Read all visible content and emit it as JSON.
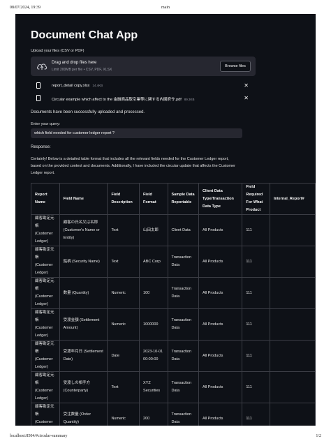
{
  "print_header": {
    "datetime": "08/07/2024, 19:39",
    "title": "main"
  },
  "print_footer": {
    "url": "localhost:8504/#circular-summary",
    "page": "1/2"
  },
  "app": {
    "title": "Document Chat App",
    "upload_label": "Upload your files (CSV or PDF)",
    "uploader": {
      "icon": "cloud-upload-icon",
      "main_text": "Drag and drop files here",
      "sub_text": "Limit 200MB per file • CSV, PDF, XLSX",
      "browse_label": "Browse files"
    },
    "files": [
      {
        "name": "report_detail copy.xlsx",
        "size": "14.4KB",
        "icon": "file-icon"
      },
      {
        "name": "Circular example which affect to the 金融商品取引業等に関する内閣府令.pdf",
        "size": "89.3KB",
        "icon": "file-icon"
      }
    ],
    "success_msg": "Documents have been successfully uploaded and processed.",
    "query_label": "Enter your query:",
    "query_value": "which field needed for customer ledger report ?",
    "response_label": "Response:",
    "response_text": "Certainly! Below is a detailed table format that includes all the relevant fields needed for the Customer Ledger report, based on the provided context and documents. Additionally, I have included the circular update that affects the Customer Ledger report.",
    "table": {
      "headers": [
        "Report Name",
        "Field Name",
        "Field Description",
        "Field Format",
        "Sample Data Reportable",
        "Client Data Type/Transaction Data Type",
        "Field Required For What Product",
        "Internal_Report#"
      ],
      "rows": [
        [
          "顧客勘定元帳 (Customer Ledger)",
          "顧客の氏名又は名称 (Customer's Name or Entity)",
          "Text",
          "山田太郎",
          "Client Data",
          "All Products",
          "111",
          ""
        ],
        [
          "顧客勘定元帳 (Customer Ledger)",
          "銘柄 (Security Name)",
          "Text",
          "ABC Corp",
          "Transaction Data",
          "All Products",
          "111",
          ""
        ],
        [
          "顧客勘定元帳 (Customer Ledger)",
          "数量 (Quantity)",
          "Numeric",
          "100",
          "Transaction Data",
          "All Products",
          "111",
          ""
        ],
        [
          "顧客勘定元帳 (Customer Ledger)",
          "受渡金額 (Settlement Amount)",
          "Numeric",
          "1000000",
          "Transaction Data",
          "All Products",
          "111",
          ""
        ],
        [
          "顧客勘定元帳 (Customer Ledger)",
          "受渡年月日 (Settlement Date)",
          "Date",
          "2023-10-01 00:00:00",
          "Transaction Data",
          "All Products",
          "111",
          ""
        ],
        [
          "顧客勘定元帳 (Customer Ledger)",
          "受渡しの相手方 (Counterparty)",
          "Text",
          "XYZ Securities",
          "Transaction Data",
          "All Products",
          "111",
          ""
        ],
        [
          "顧客勘定元帳 (Customer Ledger)",
          "受注数量 (Order Quantity)",
          "Numeric",
          "200",
          "Transaction Data",
          "All Products",
          "111",
          ""
        ]
      ]
    }
  }
}
